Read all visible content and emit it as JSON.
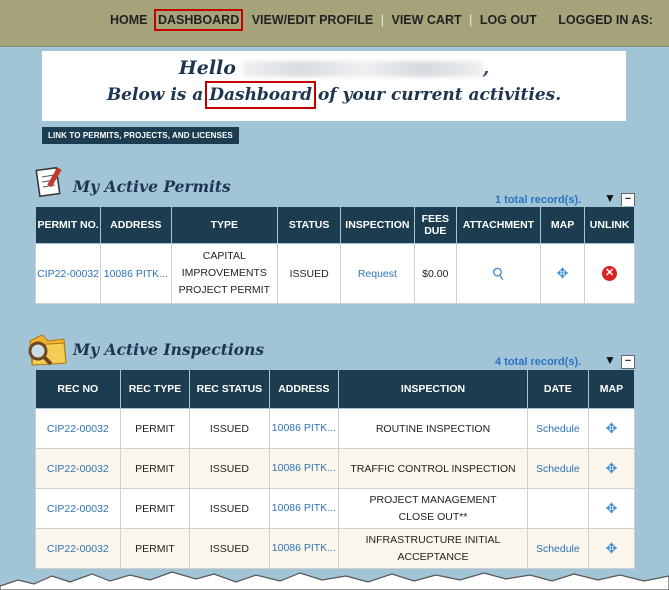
{
  "nav": {
    "home": "HOME",
    "dashboard": "DASHBOARD",
    "view_edit_profile": "VIEW/EDIT PROFILE",
    "sep": "|",
    "view_cart": "VIEW CART",
    "log_out": "LOG OUT",
    "logged_in_as": "LOGGED IN AS:"
  },
  "hello": {
    "greeting": "Hello",
    "comma": ",",
    "line2_prefix": "Below is a",
    "line2_word": "Dashboard",
    "line2_suffix": "of your current activities."
  },
  "link_button": "LINK TO PERMITS, PROJECTS, AND LICENSES",
  "permits": {
    "title": "My Active Permits",
    "records": "1 total record(s).",
    "headers": [
      "PERMIT NO.",
      "ADDRESS",
      "TYPE",
      "STATUS",
      "INSPECTION",
      "FEES DUE",
      "ATTACHMENT",
      "MAP",
      "UNLINK"
    ],
    "rows": [
      {
        "permit_no": "CIP22-00032",
        "address": "10086 PITK...",
        "type": "CAPITAL IMPROVEMENTS PROJECT PERMIT",
        "status": "ISSUED",
        "inspection": "Request",
        "fees_due": "$0.00"
      }
    ]
  },
  "inspections": {
    "title": "My Active Inspections",
    "records": "4 total record(s).",
    "headers": [
      "REC NO",
      "REC TYPE",
      "REC STATUS",
      "ADDRESS",
      "INSPECTION",
      "DATE",
      "MAP"
    ],
    "rows": [
      {
        "rec_no": "CIP22-00032",
        "rec_type": "PERMIT",
        "rec_status": "ISSUED",
        "address": "10086 PITK...",
        "inspection": "ROUTINE INSPECTION",
        "date": "Schedule"
      },
      {
        "rec_no": "CIP22-00032",
        "rec_type": "PERMIT",
        "rec_status": "ISSUED",
        "address": "10086 PITK...",
        "inspection": "TRAFFIC CONTROL INSPECTION",
        "date": "Schedule"
      },
      {
        "rec_no": "CIP22-00032",
        "rec_type": "PERMIT",
        "rec_status": "ISSUED",
        "address": "10086 PITK...",
        "inspection": "PROJECT MANAGEMENT CLOSE OUT**",
        "date": ""
      },
      {
        "rec_no": "CIP22-00032",
        "rec_type": "PERMIT",
        "rec_status": "ISSUED",
        "address": "10086 PITK...",
        "inspection": "INFRASTRUCTURE INITIAL ACCEPTANCE",
        "date": "Schedule"
      }
    ]
  },
  "icons": {
    "filter": "filter-icon",
    "collapse": "minus-icon",
    "attachment": "paperclip-icon",
    "map": "move-arrows-icon",
    "unlink": "red-x-circle-icon"
  },
  "colors": {
    "header_bar": "#a4a37a",
    "page_bg": "#a2c4d7",
    "table_header": "#1c3d50",
    "link": "#2f74b8",
    "highlight_box": "#c00000"
  }
}
